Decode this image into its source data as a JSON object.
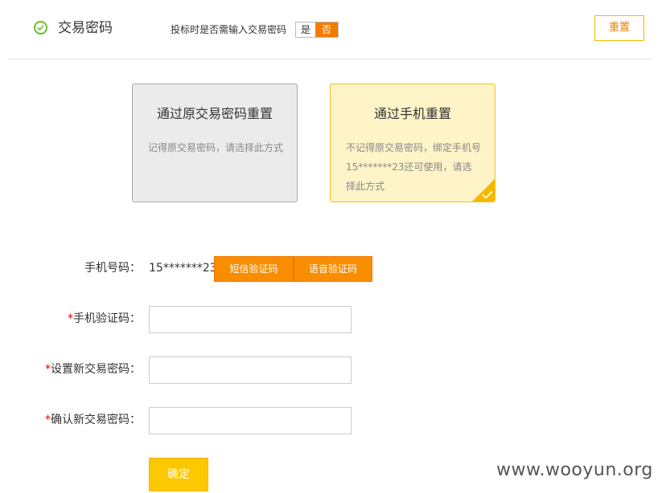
{
  "header": {
    "section_title": "交易密码",
    "bid_prompt": "投标时是否需输入交易密码",
    "toggle_yes": "是",
    "toggle_no": "否",
    "toggle_selected": "否",
    "reset_label": "重置"
  },
  "options": {
    "old_password": {
      "title": "通过原交易密码重置",
      "description": "记得原交易密码，请选择此方式"
    },
    "phone": {
      "title": "通过手机重置",
      "description": "不记得原交易密码，绑定手机号 15*******23还可使用，请选择此方式",
      "selected": true
    }
  },
  "form": {
    "phone_label": "手机号码：",
    "phone_value": "15*******23",
    "sms_code_button": "短信验证码",
    "voice_code_button": "语音验证码",
    "required_mark": "*",
    "verify_code_label": "手机验证码：",
    "verify_code_value": "",
    "new_password_label": "设置新交易密码：",
    "new_password_value": "",
    "confirm_password_label": "确认新交易密码：",
    "confirm_password_value": "",
    "submit_label": "确定"
  },
  "watermark": "www.wooyun.org",
  "colors": {
    "accent_orange": "#f98d00",
    "accent_yellow": "#fcc800",
    "check_green": "#6cbf2c",
    "required_red": "#e60000"
  }
}
